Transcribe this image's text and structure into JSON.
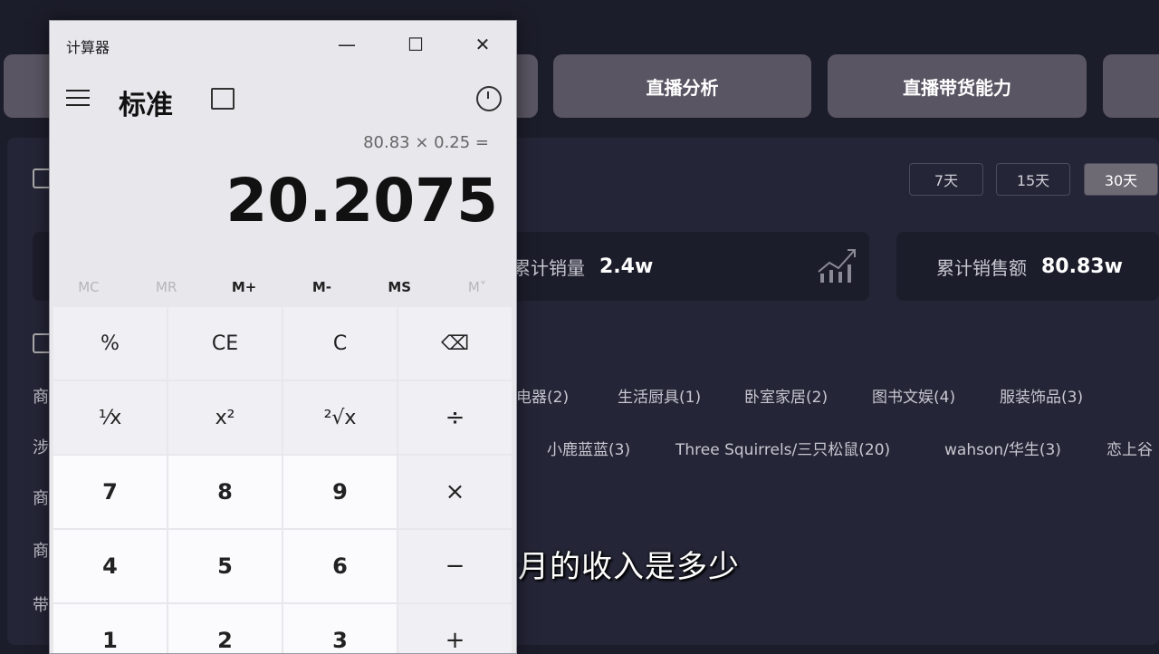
{
  "dashboard": {
    "tabs": [
      "直播分析",
      "直播带货能力"
    ],
    "ranges": [
      "7天",
      "15天",
      "30天"
    ],
    "active_range": "30天",
    "stats": [
      {
        "label": "累计销量",
        "value": "2.4w"
      },
      {
        "label": "累计销售额",
        "value": "80.83w"
      }
    ],
    "category_tags": [
      "电器(2)",
      "生活厨具(1)",
      "卧室家居(2)",
      "图书文娱(4)",
      "服装饰品(3)"
    ],
    "brand_tags": [
      "小鹿蓝蓝(3)",
      "Three Squirrels/三只松鼠(20)",
      "wahson/华生(3)",
      "恋上谷"
    ],
    "side_labels": [
      "商",
      "涉",
      "商",
      "商",
      "带"
    ]
  },
  "subtitle": "他这一个月的收入是多少",
  "calculator": {
    "title": "计算器",
    "mode": "标准",
    "expression": "80.83 × 0.25 =",
    "display": "20.2075",
    "window_controls": {
      "minimize": "—",
      "maximize": "☐",
      "close": "✕"
    },
    "memory": [
      "MC",
      "MR",
      "M+",
      "M-",
      "MS",
      "M˅"
    ],
    "keys": [
      "%",
      "CE",
      "C",
      "⌫",
      "¹⁄x",
      "x²",
      "²√x",
      "÷",
      "7",
      "8",
      "9",
      "×",
      "4",
      "5",
      "6",
      "−",
      "1",
      "2",
      "3",
      "+"
    ]
  }
}
